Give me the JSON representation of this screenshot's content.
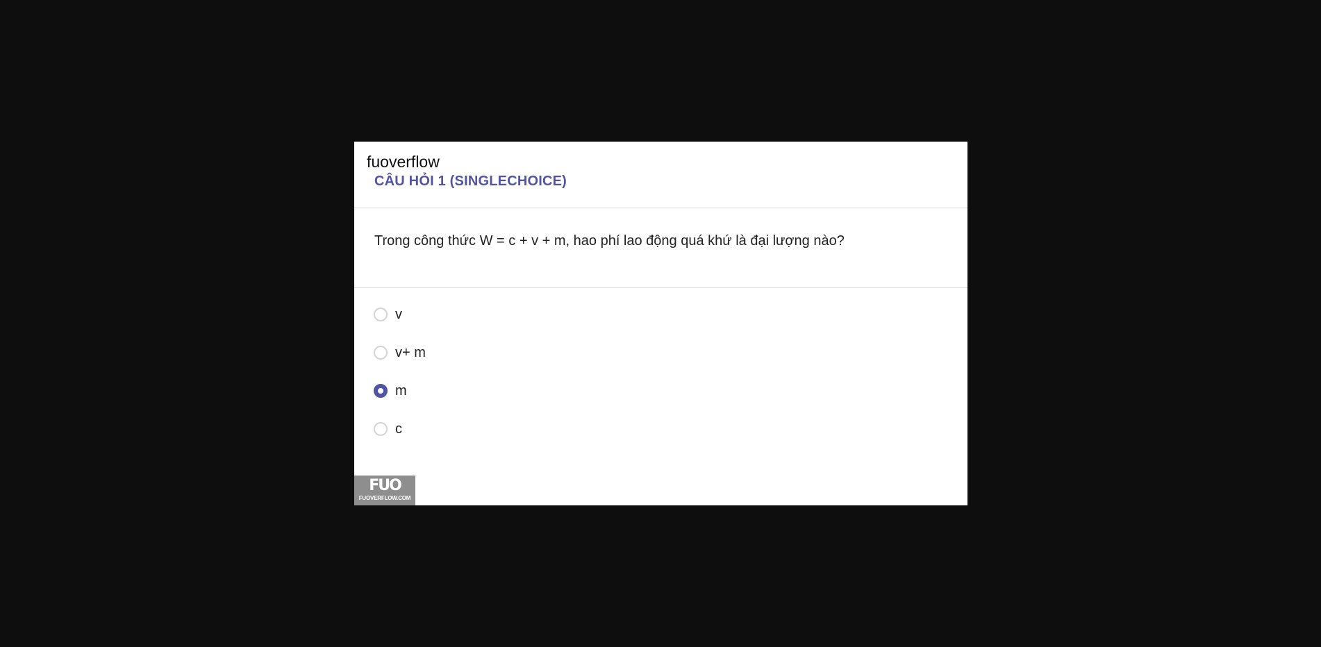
{
  "header": {
    "site_name": "fuoverflow",
    "question_title": "CÂU HỎI 1 (SINGLECHOICE)"
  },
  "question": {
    "text": "Trong công thức W = c + v + m, hao phí lao động quá khứ là đại lượng nào?"
  },
  "options": [
    {
      "label": "v",
      "selected": false
    },
    {
      "label": "v+ m",
      "selected": false
    },
    {
      "label": "m",
      "selected": true
    },
    {
      "label": "c",
      "selected": false
    }
  ],
  "watermark": {
    "logo": "FUO",
    "domain": "FUOVERFLOW.COM"
  },
  "colors": {
    "accent": "#5254a3",
    "background": "#0e0e0e",
    "card": "#ffffff"
  }
}
